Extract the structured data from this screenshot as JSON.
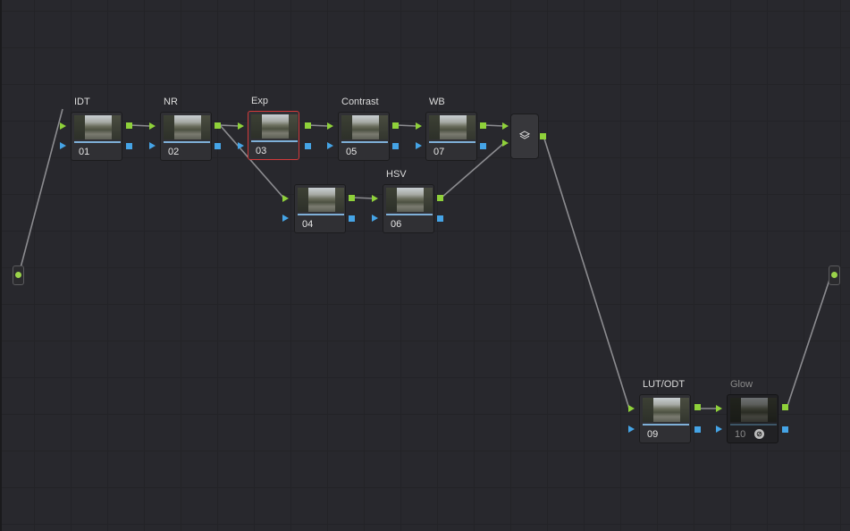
{
  "colors": {
    "background": "#28282d",
    "rgb_port": "#8fd13a",
    "key_port": "#45a4e6",
    "selected_border": "#d23a3a",
    "wire": "#8c8c90"
  },
  "nodes": [
    {
      "title": "IDT",
      "number": "01"
    },
    {
      "title": "NR",
      "number": "02"
    },
    {
      "title": "Exp",
      "number": "03",
      "selected": true
    },
    {
      "title": "",
      "number": "04"
    },
    {
      "title": "Contrast",
      "number": "05"
    },
    {
      "title": "HSV",
      "number": "06"
    },
    {
      "title": "WB",
      "number": "07"
    },
    {
      "title": "LUT/ODT",
      "number": "09"
    },
    {
      "title": "Glow",
      "number": "10",
      "disabled": true
    }
  ],
  "layer_mixer": {
    "icon": "layers-icon"
  },
  "source_input": {
    "icon": "input-dot"
  },
  "output": {
    "icon": "output-dot"
  }
}
